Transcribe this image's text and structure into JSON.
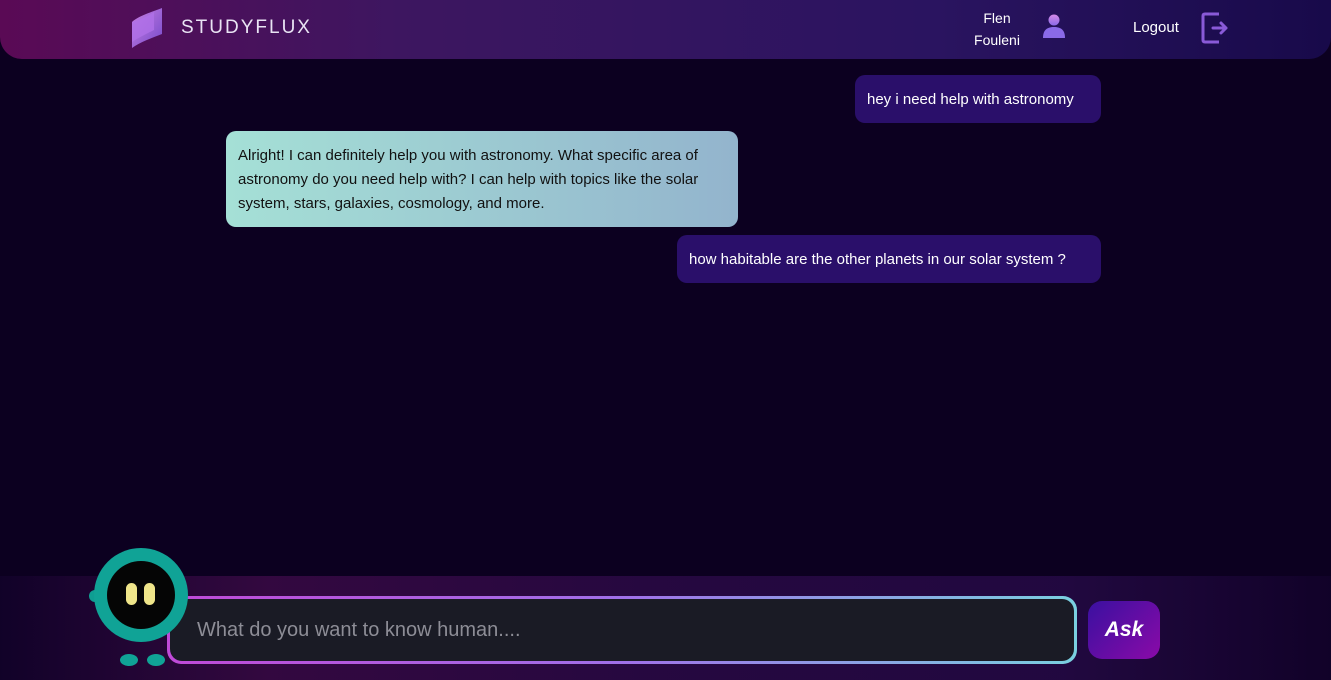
{
  "header": {
    "app_name": "STUDYFLUX",
    "user_first_name": "Flen",
    "user_last_name": "Fouleni",
    "logout_label": "Logout"
  },
  "chat": {
    "messages": [
      {
        "role": "user",
        "text": "hey i need help with astronomy"
      },
      {
        "role": "bot",
        "text": "Alright! I can definitely help you with astronomy. What specific area of astronomy do you need help with? I can help with topics like the solar system, stars, galaxies, cosmology, and more."
      },
      {
        "role": "user",
        "text": "how habitable are the other planets in our solar system ?"
      }
    ]
  },
  "composer": {
    "placeholder": "What do you want to know human....",
    "value": "",
    "ask_label": "Ask"
  },
  "icons": {
    "logo": "studyflux-logo-icon",
    "user": "user-icon",
    "logout": "logout-icon",
    "mascot": "robot-mascot-icon"
  },
  "colors": {
    "background": "#0c0020",
    "user_bubble": "#2a0f6a",
    "bot_bubble_start": "#a5e0d6",
    "bot_bubble_end": "#93b4cd",
    "accent": "#8a0aa8"
  }
}
